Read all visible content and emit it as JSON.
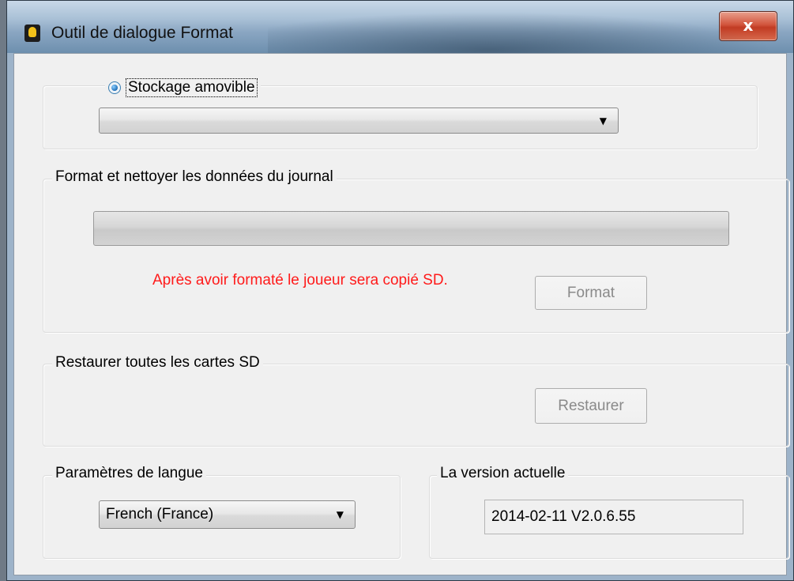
{
  "window": {
    "title": "Outil de dialogue Format",
    "close_glyph": "x"
  },
  "storage": {
    "radio_label": "Stockage amovible",
    "radio_selected": true,
    "device_select_value": ""
  },
  "format_group": {
    "legend": "Format et nettoyer les données du journal",
    "progress_percent": 0,
    "warning_text": "Après avoir formaté le joueur sera copié SD.",
    "warning_color": "#ff1a1a",
    "format_button": "Format",
    "format_button_enabled": false
  },
  "restore_group": {
    "legend": "Restaurer toutes les cartes SD",
    "restore_button": "Restaurer",
    "restore_button_enabled": false
  },
  "language_group": {
    "legend": "Paramètres de langue",
    "selected_language": "French (France)"
  },
  "version_group": {
    "legend": "La version actuelle",
    "version_value": "2014-02-11 V2.0.6.55"
  },
  "icons": {
    "app": "bulb-icon",
    "close": "close-icon",
    "dropdown": "chevron-down-icon"
  }
}
